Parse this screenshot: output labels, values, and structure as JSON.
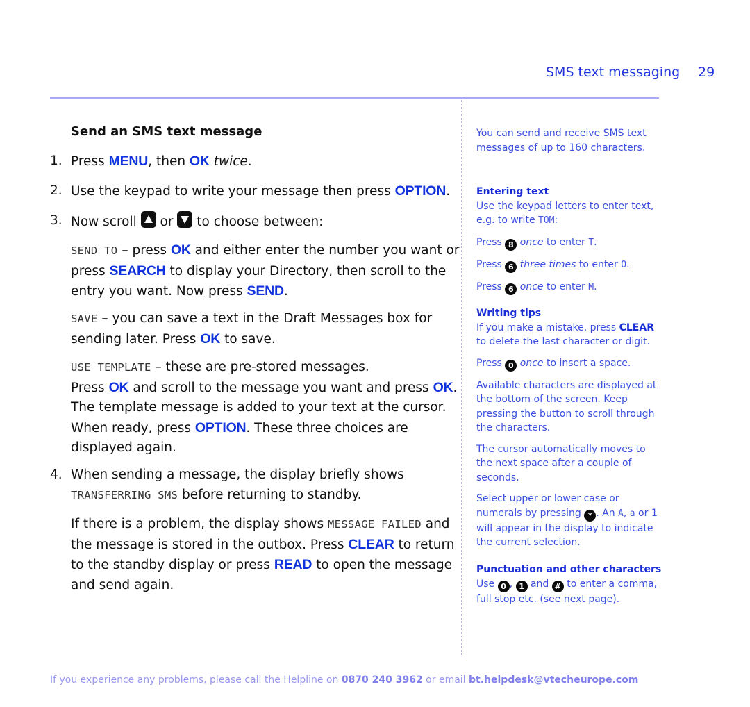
{
  "header": {
    "section_title": "SMS text messaging",
    "page_number": "29"
  },
  "main": {
    "heading": "Send an SMS text message",
    "step1": {
      "num": "1.",
      "a": "Press ",
      "kw1": "MENU",
      "b": ", then ",
      "kw2": "OK",
      "c": " ",
      "it": "twice",
      "d": "."
    },
    "step2": {
      "num": "2.",
      "a": "Use the keypad to write your message then press ",
      "kw": "OPTION",
      "b": "."
    },
    "step3": {
      "num": "3.",
      "a": "Now scroll ",
      "up_icon": "scroll-up-key",
      "b": " or ",
      "down_icon": "scroll-down-key",
      "c": " to choose between:"
    },
    "send_to": {
      "lcd": "SEND TO",
      "a": " – press ",
      "kw1": "OK",
      "b": " and either enter the number you want or press ",
      "kw2": "SEARCH",
      "c": " to display your Directory, then scroll to the entry you want. Now press ",
      "kw3": "SEND",
      "d": "."
    },
    "save": {
      "lcd": "SAVE",
      "a": " – you can save a text in the Draft Messages box for sending later. Press ",
      "kw": "OK",
      "b": " to save."
    },
    "use_template": {
      "lcd": "USE TEMPLATE",
      "a": " – these are pre-stored messages.",
      "b": "Press ",
      "kw1": "OK",
      "c": " and scroll to the message you want and press ",
      "kw2": "OK",
      "d": ". The template message is added to your text at the cursor. When ready, press ",
      "kw3": "OPTION",
      "e": ". These three choices are displayed again."
    },
    "step4": {
      "num": "4.",
      "a": "When sending a message, the display briefly shows ",
      "lcd": "TRANSFERRING SMS",
      "b": " before returning to standby."
    },
    "problem": {
      "a": "If there is a problem, the display shows ",
      "lcd": "MESSAGE FAILED",
      "b": " and the message is stored in the outbox. Press ",
      "kw1": "CLEAR",
      "c": " to return to the standby display or press ",
      "kw2": "READ",
      "d": " to open the message and send again."
    }
  },
  "sidebar": {
    "intro": "You can send and receive SMS text messages of up to 160 characters.",
    "entering": {
      "heading": "Entering text",
      "text": "Use the keypad letters to enter text, e.g. to write ",
      "lcd": "TOM",
      "colon": ":",
      "lines": [
        {
          "press": "Press ",
          "key": "8",
          "it": "once",
          "rest": " to enter ",
          "lcd": "T",
          "end": "."
        },
        {
          "press": "Press ",
          "key": "6",
          "it": "three times",
          "rest": " to enter ",
          "lcd": "O",
          "end": "."
        },
        {
          "press": "Press ",
          "key": "6",
          "it": "once",
          "rest": " to enter ",
          "lcd": "M",
          "end": "."
        }
      ]
    },
    "tips": {
      "heading": "Writing tips",
      "mistake_a": "If you make a mistake, press ",
      "mistake_kw": "CLEAR",
      "mistake_b": " to delete the last character or digit.",
      "space": {
        "press": "Press ",
        "key": "0",
        "it": "once",
        "rest": " to insert a space."
      },
      "available": "Available characters are displayed at the bottom of the screen. Keep pressing the button to scroll through the characters.",
      "cursor": "The cursor automatically moves to the next space after a couple of seconds.",
      "case_a": "Select upper or lower case or numerals by pressing ",
      "case_key": "*",
      "case_b": ". An ",
      "case_lcd1": "A",
      "case_c": ", ",
      "case_lcd2": "a",
      "case_d": " or ",
      "case_lcd3": "1",
      "case_e": " will appear in the display to indicate the current selection."
    },
    "punct": {
      "heading": "Punctuation and other characters",
      "a": "Use ",
      "key1": "0",
      "b": ", ",
      "key2": "1",
      "c": " and ",
      "key3": "#",
      "d": " to enter a comma, full stop etc. (see next page)."
    }
  },
  "footer": {
    "a": "If you experience any problems, please call the Helpline on ",
    "phone": "0870 240 3962",
    "b": " or email ",
    "email": "bt.helpdesk@vtecheurope.com"
  },
  "colors": {
    "accent": "#1133dd",
    "sidebar_text": "#3a4fe0",
    "rule": "#a8a8f8",
    "footer": "#9898f0"
  }
}
